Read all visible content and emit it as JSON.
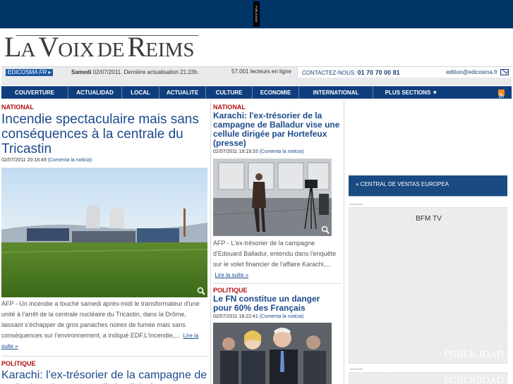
{
  "top": {
    "publicidad_tag": "PUBLICIDAD"
  },
  "masthead": {
    "logo": {
      "la": "La",
      "voix": "Voix",
      "de": "de",
      "reims": "Reims"
    }
  },
  "infobar": {
    "edicosma_label": "EDICOSMA",
    "edicosma_fr": "FR",
    "date_day": "Samedi",
    "date_rest": "02/07/2011. Dernière actualisation 21:23h.",
    "readers": "57.001 lecteurs en ligne",
    "contact_label": "CONTACTEZ-NOUS:",
    "contact_phone": "01 70 70 00 81",
    "email": "edition@edicosma.fr"
  },
  "nav": {
    "items": [
      {
        "label": "COUVERTURE"
      },
      {
        "label": "ACTUALIDAD"
      },
      {
        "label": "LOCAL"
      },
      {
        "label": "ACTUALITE"
      },
      {
        "label": "CULTURE"
      },
      {
        "label": "ECONOMIE"
      },
      {
        "label": "INTERNATIONAL"
      },
      {
        "label": "PLUS SECTIONS  ▼"
      }
    ]
  },
  "col1": {
    "a1": {
      "section": "NATIONAL",
      "title": "Incendie spectaculaire mais sans conséquences à la centrale du Tricastin",
      "datetime": "02/07/2011 20:18:49",
      "comment": "(Comenta la noticia)",
      "teaser": "AFP - Un incendie a touché samedi après-midi le transformateur d'une unité à l'arrêt de la centrale nucléaire du Tricastin, dans la Drôme, laissant s'échapper de gros panaches noires de fumée mais sans conséquences sur l'environnement, a indiqué EDF.L'incendie,...",
      "more": "Lire la suite »"
    },
    "a2": {
      "section": "POLITIQUE",
      "title": "Karachi: l'ex-trésorier de la campagne de Balladur vise une cellule dirigée par"
    }
  },
  "col2": {
    "a1": {
      "section": "NATIONAL",
      "title": "Karachi: l'ex-trésorier de la campagne de Balladur vise une cellule dirigée par Hortefeux (presse)",
      "datetime": "02/07/2011 19:19:33",
      "comment": "(Comenta la noticia)",
      "teaser": "AFP - L'ex-trésorier de la campagne d'Edouard Balladur, entendu dans l'enquête sur le volet financier de l'affaire Karachi,...",
      "more": "Lire la suite »"
    },
    "a2": {
      "section": "POLITIQUE",
      "title": "Le FN constitue un danger pour 60% des Français",
      "datetime": "02/07/2011 18:22:41",
      "comment": "(Comenta la noticia)"
    }
  },
  "col3": {
    "banner": "» CENTRAL DE VENTAS EUROPEA",
    "pub_label": "publicidad",
    "ad1_title": "BFM TV",
    "ad_logo": "PUBLICIDAD"
  }
}
